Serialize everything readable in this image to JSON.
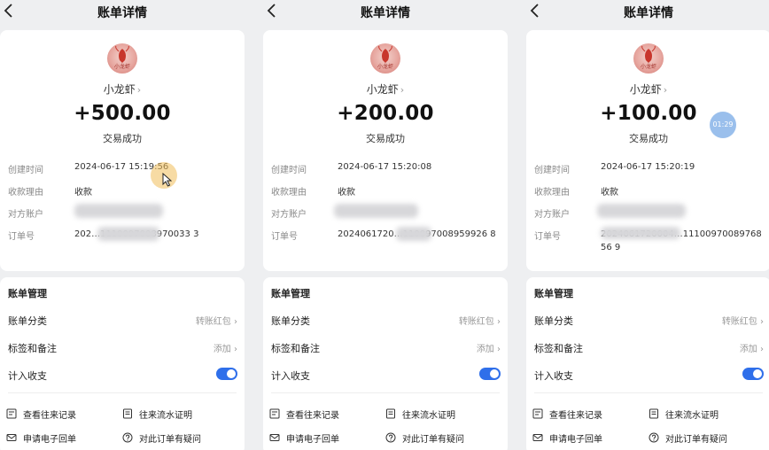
{
  "colors": {
    "accent": "#2f6fea",
    "background": "#eeeff1",
    "card": "#ffffff",
    "muted_text": "#888888"
  },
  "field_labels": {
    "created_time": "创建时间",
    "reason": "收款理由",
    "counterparty": "对方账户",
    "order_no": "订单号"
  },
  "management": {
    "title": "账单管理",
    "category_label": "账单分类",
    "category_value": "转账红包",
    "tags_label": "标签和备注",
    "tags_value": "添加",
    "include_label": "计入收支",
    "include_on": true
  },
  "actions": {
    "records": "查看往来记录",
    "flow_proof": "往来流水证明",
    "e_receipt": "申请电子回单",
    "question": "对此订单有疑问"
  },
  "icons": {
    "back": "chevron-left-icon",
    "merchant": "lobster-logo",
    "records": "records-icon",
    "flow_proof": "document-icon",
    "e_receipt": "mail-icon",
    "question": "question-circle-icon"
  },
  "screens": [
    {
      "title": "账单详情",
      "logo_text": "小龙虾",
      "merchant": "小龙虾",
      "amount": "+500.00",
      "status": "交易成功",
      "created_time": "2024-06-17 15:19:56",
      "reason": "收款",
      "order_no_visible": "202…1110097008970033 3"
    },
    {
      "title": "账单详情",
      "logo_text": "小龙虾",
      "merchant": "小龙虾",
      "amount": "+200.00",
      "status": "交易成功",
      "created_time": "2024-06-17 15:20:08",
      "reason": "收款",
      "order_no_visible": "2024061720…110097008959926 8"
    },
    {
      "title": "账单详情",
      "logo_text": "小龙虾",
      "merchant": "小龙虾",
      "amount": "+100.00",
      "status": "交易成功",
      "created_time": "2024-06-17 15:20:19",
      "reason": "收款",
      "order_no_visible": "2024061720004…1110097008976856 9"
    }
  ],
  "overlay": {
    "timer": "01:29"
  }
}
